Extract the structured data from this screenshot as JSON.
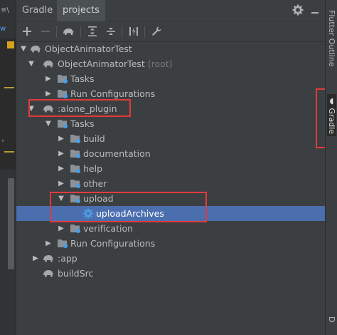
{
  "header": {
    "tabs": [
      "Gradle",
      "projects"
    ],
    "settings_icon": "gear-icon",
    "minimize_icon": "minimize-icon"
  },
  "toolbar": {
    "icons": [
      "plus-icon",
      "minus-icon",
      "elephant-icon",
      "expand-all-icon",
      "collapse-all-icon",
      "toggle-offline-icon",
      "wrench-icon"
    ]
  },
  "tree": {
    "project": "ObjectAnimatorTest",
    "root_module": "ObjectAnimatorTest",
    "root_suffix": "(root)",
    "tasks": "Tasks",
    "run_configurations": "Run Configurations",
    "alone_plugin": ":alone_plugin",
    "plugin_tasks": "Tasks",
    "groups": [
      "build",
      "documentation",
      "help",
      "other",
      "upload"
    ],
    "upload_archives": "uploadArchives",
    "verification": "verification",
    "plugin_run_configurations": "Run Configurations",
    "app": ":app",
    "build_src": "buildSrc"
  },
  "right_strip": {
    "flutter_outline": "Flutter Outline",
    "gradle": "Gradle",
    "bottom": "D"
  },
  "left_strip": {
    "glyph": "≡\\",
    "blue": "w",
    "quote": "\""
  },
  "colors": {
    "background": "#3c3f41",
    "selection": "#4b6eaf",
    "annotation": "#e23a3a",
    "elephant": "#a7a7a7",
    "gear_blue": "#4aa0e6"
  }
}
